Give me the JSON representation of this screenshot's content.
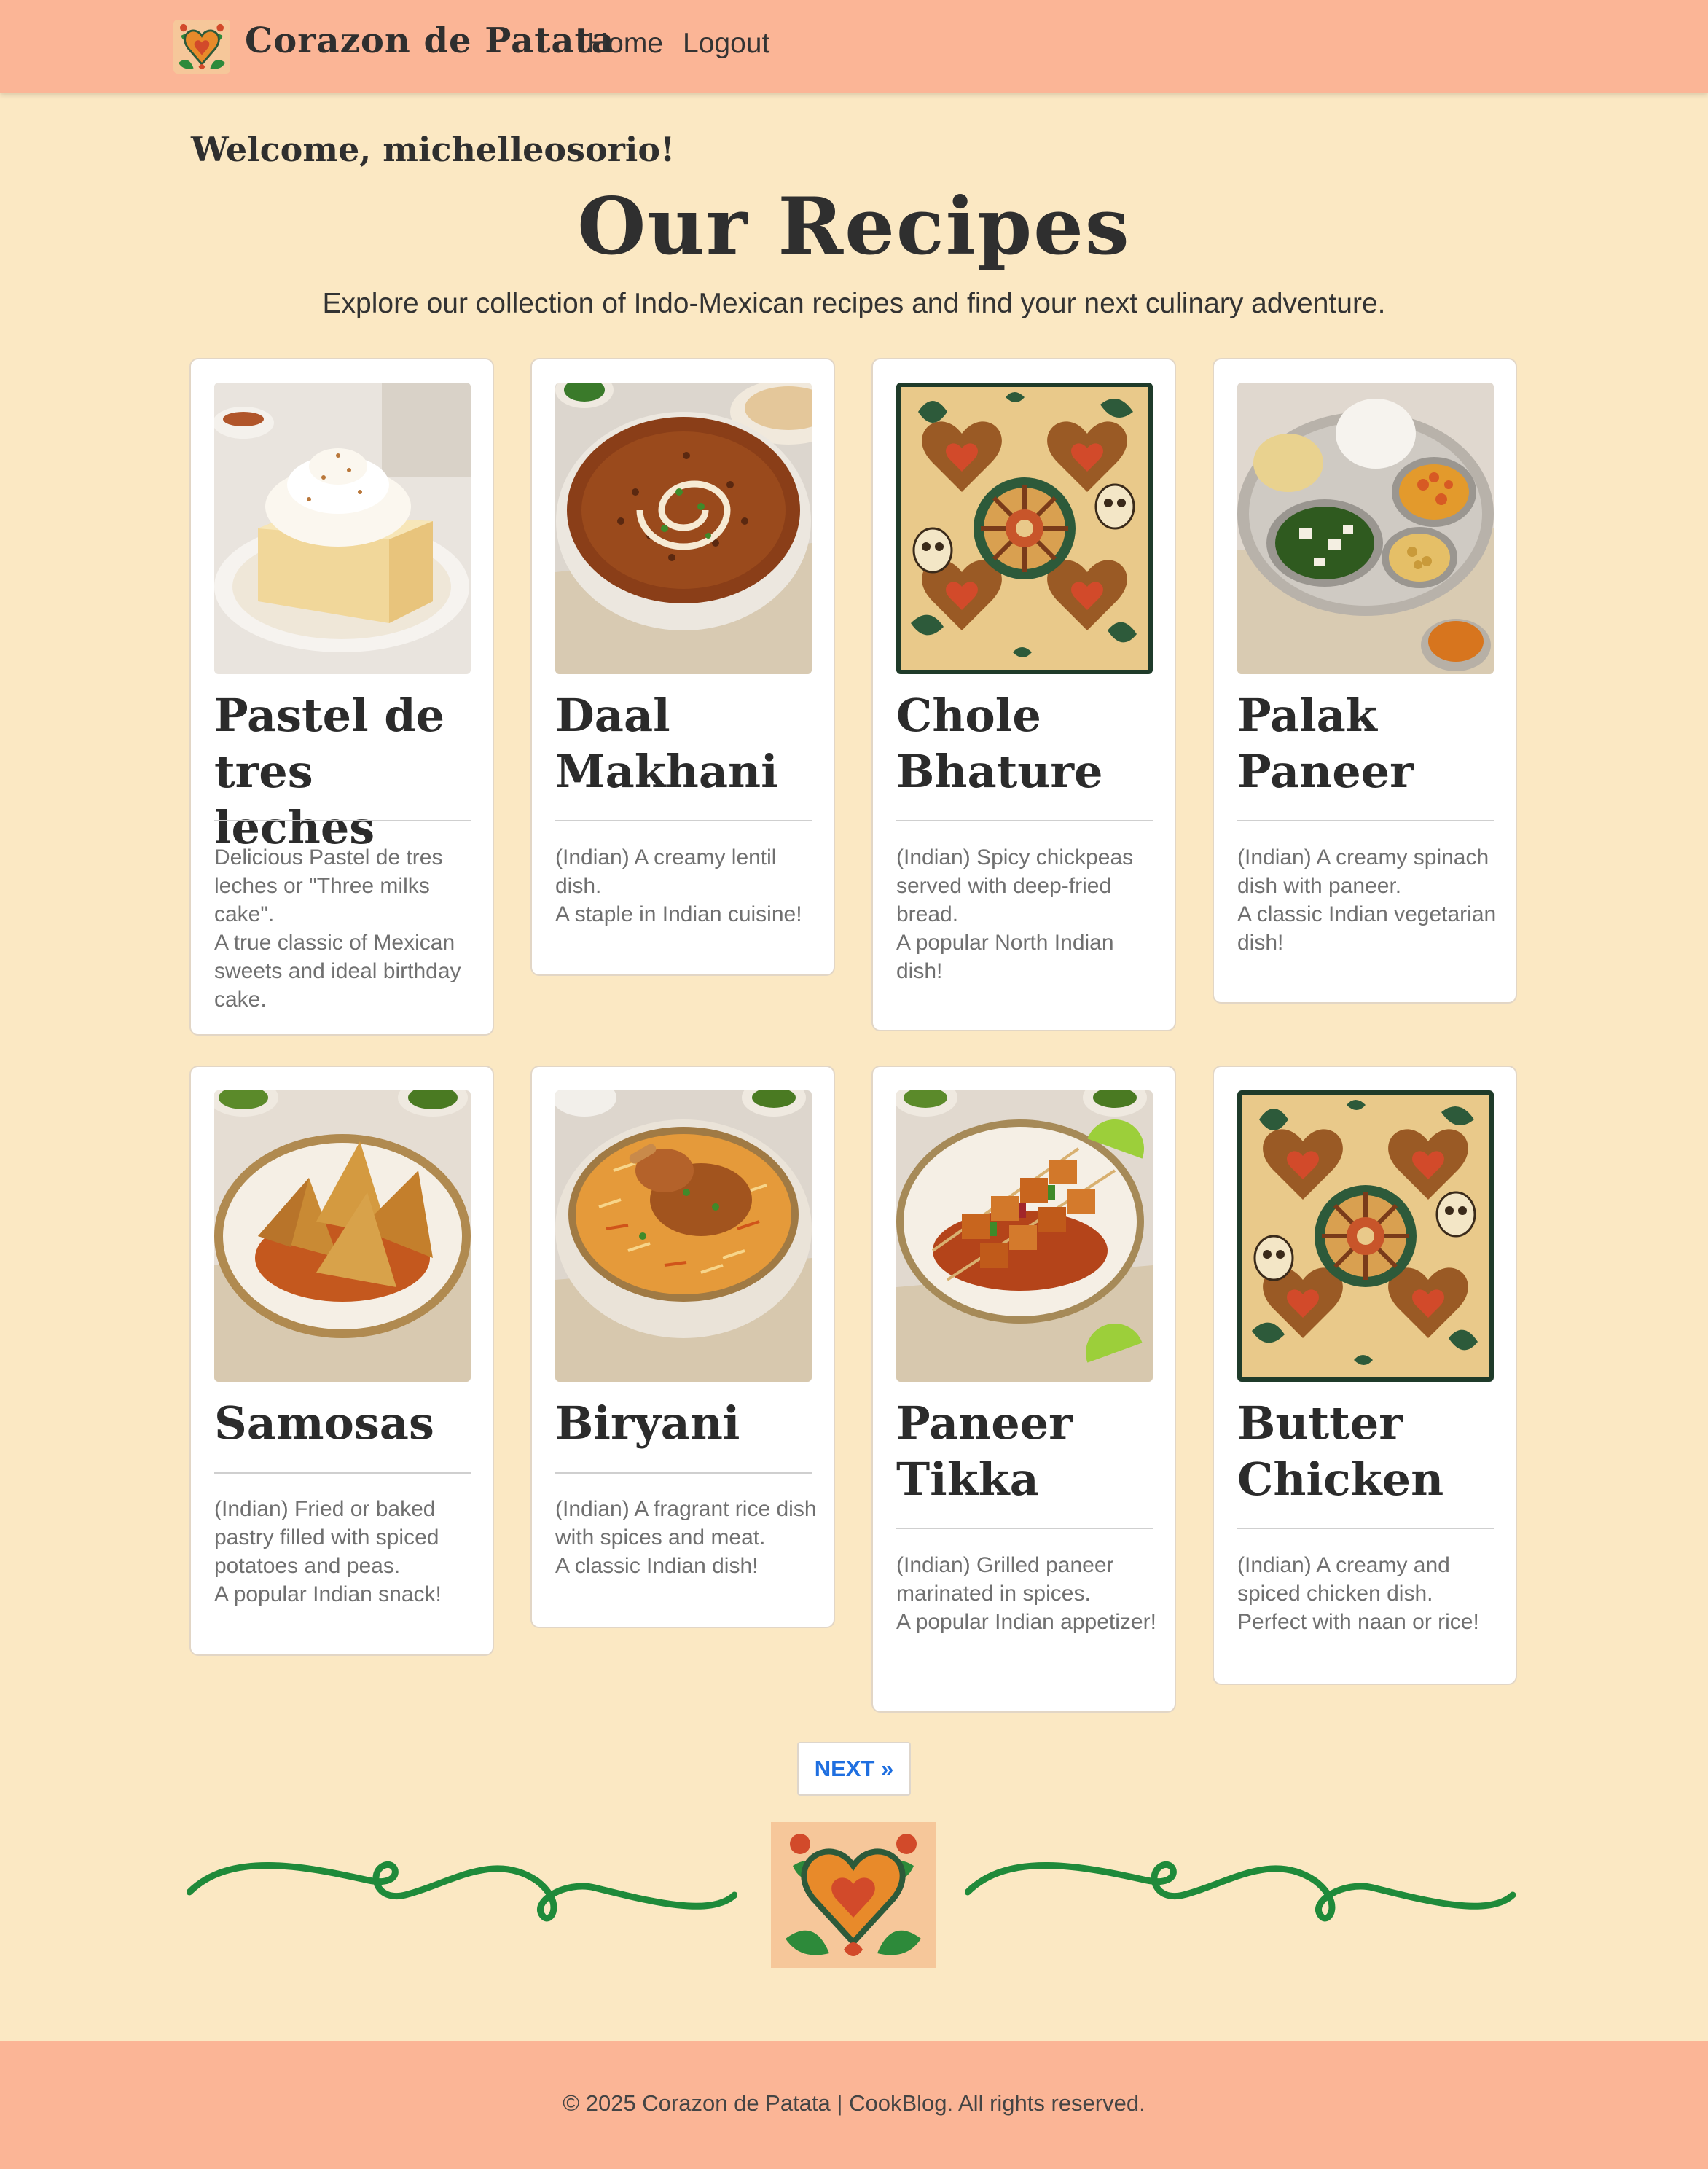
{
  "nav": {
    "brand": "Corazon de Patata",
    "home": "Home",
    "logout": "Logout"
  },
  "welcome": "Welcome, michelleosorio!",
  "title": "Our Recipes",
  "subtitle": "Explore our collection of Indo-Mexican recipes and find your next culinary adventure.",
  "recipes": [
    {
      "title": "Pastel de tres leches",
      "desc": [
        "Delicious Pastel de tres leches or \"Three milks cake\".",
        "A true classic of Mexican sweets and ideal birthday cake."
      ],
      "image": "cake-slice"
    },
    {
      "title": "Daal Makhani",
      "desc": [
        "(Indian) A creamy lentil dish.",
        "A staple in Indian cuisine!"
      ],
      "image": "lentil-bowl"
    },
    {
      "title": "Chole Bhature",
      "desc": [
        "(Indian) Spicy chickpeas served with deep-fried bread.",
        "A popular North Indian dish!"
      ],
      "image": "folk-art-pattern"
    },
    {
      "title": "Palak Paneer",
      "desc": [
        "(Indian) A creamy spinach dish with paneer.",
        "A classic Indian vegetarian dish!"
      ],
      "image": "thali-plate"
    },
    {
      "title": "Samosas",
      "desc": [
        "(Indian) Fried or baked pastry filled with spiced potatoes and peas.",
        "A popular Indian snack!"
      ],
      "image": "samosa-plate"
    },
    {
      "title": "Biryani",
      "desc": [
        "(Indian) A fragrant rice dish with spices and meat.",
        "A classic Indian dish!"
      ],
      "image": "biryani-bowl"
    },
    {
      "title": "Paneer Tikka",
      "desc": [
        "(Indian) Grilled paneer marinated in spices.",
        "A popular Indian appetizer!"
      ],
      "image": "tikka-skewers"
    },
    {
      "title": "Butter Chicken",
      "desc": [
        "(Indian) A creamy and spiced chicken dish.",
        "Perfect with naan or rice!"
      ],
      "image": "folk-art-pattern"
    }
  ],
  "pagination": {
    "next": "NEXT »"
  },
  "footer": "© 2025 Corazon de Patata | CookBlog. All rights reserved.",
  "colors": {
    "header": "#fbb596",
    "background": "#fbe8c3",
    "accent": "#1f6fe0",
    "vine": "#1f8a3a"
  }
}
